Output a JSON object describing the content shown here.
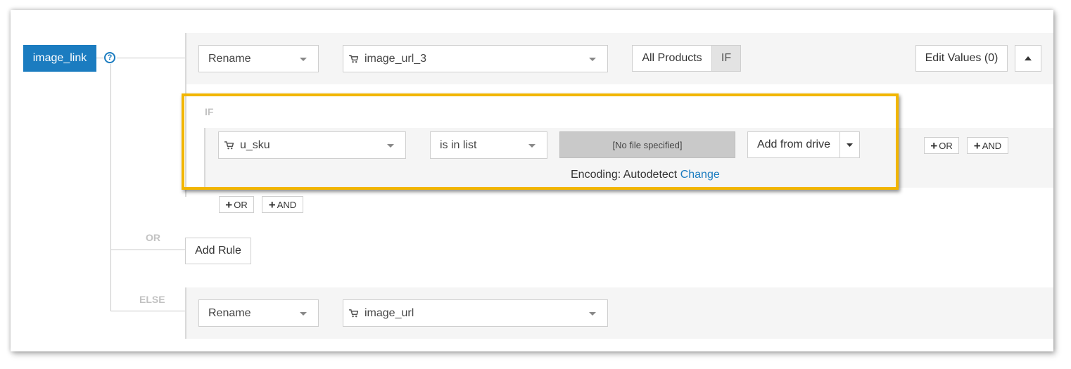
{
  "field": {
    "name": "image_link",
    "help_icon": "?"
  },
  "rule_main": {
    "action": "Rename",
    "source_field": "image_url_3",
    "scope_all": "All Products",
    "scope_if": "IF",
    "edit_values": "Edit Values (0)"
  },
  "condition": {
    "section_label": "IF",
    "field": "u_sku",
    "operator": "is in list",
    "file_status": "[No file specified]",
    "add_from_drive": "Add from drive",
    "encoding_label": "Encoding: Autodetect",
    "encoding_change": "Change",
    "or_label": "OR",
    "and_label": "AND"
  },
  "group_buttons": {
    "or_label": "OR",
    "and_label": "AND"
  },
  "or_section": {
    "label": "OR",
    "add_rule": "Add Rule"
  },
  "else_section": {
    "label": "ELSE",
    "action": "Rename",
    "source_field": "image_url"
  },
  "colors": {
    "accent": "#1b7cc0",
    "highlight": "#f2b600"
  }
}
